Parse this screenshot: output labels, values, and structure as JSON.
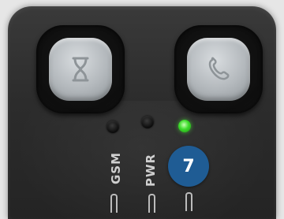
{
  "buttons": [
    {
      "icon": "hourglass-icon"
    },
    {
      "icon": "phone-icon"
    }
  ],
  "indicators": {
    "gsm": {
      "label": "GSM",
      "state": "off"
    },
    "pwr": {
      "label": "PWR",
      "state": "off"
    },
    "third": {
      "state": "on",
      "color": "#3ddc2b"
    }
  },
  "callout": {
    "number": "7",
    "color": "#1f5c94"
  }
}
